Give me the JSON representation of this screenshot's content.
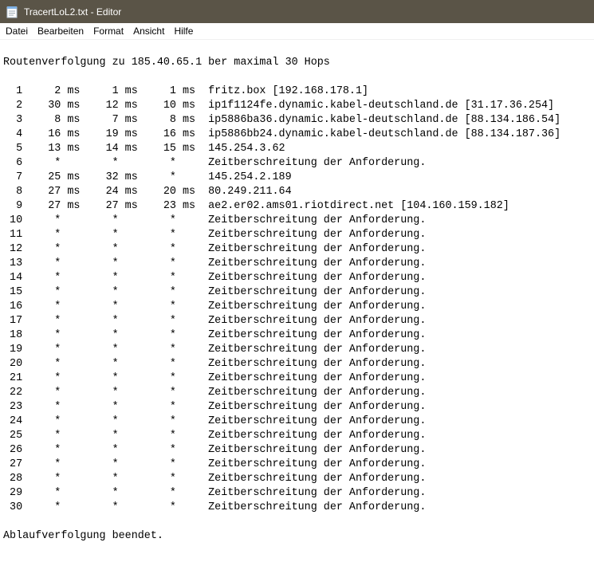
{
  "window": {
    "title": "TracertLoL2.txt - Editor",
    "icon": "notepad-icon"
  },
  "menu": {
    "file": "Datei",
    "edit": "Bearbeiten",
    "format": "Format",
    "view": "Ansicht",
    "help": "Hilfe"
  },
  "document": {
    "lines": [
      "",
      "Routenverfolgung zu 185.40.65.1 ber maximal 30 Hops",
      "",
      "  1     2 ms     1 ms     1 ms  fritz.box [192.168.178.1]",
      "  2    30 ms    12 ms    10 ms  ip1f1124fe.dynamic.kabel-deutschland.de [31.17.36.254]",
      "  3     8 ms     7 ms     8 ms  ip5886ba36.dynamic.kabel-deutschland.de [88.134.186.54]",
      "  4    16 ms    19 ms    16 ms  ip5886bb24.dynamic.kabel-deutschland.de [88.134.187.36]",
      "  5    13 ms    14 ms    15 ms  145.254.3.62",
      "  6     *        *        *     Zeitberschreitung der Anforderung.",
      "  7    25 ms    32 ms     *     145.254.2.189",
      "  8    27 ms    24 ms    20 ms  80.249.211.64",
      "  9    27 ms    27 ms    23 ms  ae2.er02.ams01.riotdirect.net [104.160.159.182]",
      " 10     *        *        *     Zeitberschreitung der Anforderung.",
      " 11     *        *        *     Zeitberschreitung der Anforderung.",
      " 12     *        *        *     Zeitberschreitung der Anforderung.",
      " 13     *        *        *     Zeitberschreitung der Anforderung.",
      " 14     *        *        *     Zeitberschreitung der Anforderung.",
      " 15     *        *        *     Zeitberschreitung der Anforderung.",
      " 16     *        *        *     Zeitberschreitung der Anforderung.",
      " 17     *        *        *     Zeitberschreitung der Anforderung.",
      " 18     *        *        *     Zeitberschreitung der Anforderung.",
      " 19     *        *        *     Zeitberschreitung der Anforderung.",
      " 20     *        *        *     Zeitberschreitung der Anforderung.",
      " 21     *        *        *     Zeitberschreitung der Anforderung.",
      " 22     *        *        *     Zeitberschreitung der Anforderung.",
      " 23     *        *        *     Zeitberschreitung der Anforderung.",
      " 24     *        *        *     Zeitberschreitung der Anforderung.",
      " 25     *        *        *     Zeitberschreitung der Anforderung.",
      " 26     *        *        *     Zeitberschreitung der Anforderung.",
      " 27     *        *        *     Zeitberschreitung der Anforderung.",
      " 28     *        *        *     Zeitberschreitung der Anforderung.",
      " 29     *        *        *     Zeitberschreitung der Anforderung.",
      " 30     *        *        *     Zeitberschreitung der Anforderung.",
      "",
      "Ablaufverfolgung beendet."
    ]
  },
  "colors": {
    "titlebar_bg": "#5a5447",
    "titlebar_text": "#ffffff",
    "editor_bg": "#ffffff",
    "editor_text": "#000000"
  }
}
